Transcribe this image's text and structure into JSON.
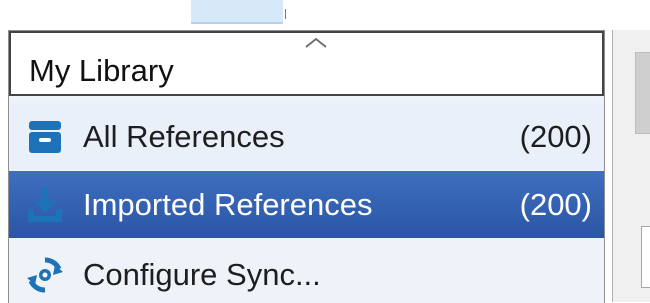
{
  "library": {
    "title": "My Library",
    "items": [
      {
        "label": "All References",
        "count": "(200)",
        "icon": "archive-box-icon"
      },
      {
        "label": "Imported References",
        "count": "(200)",
        "icon": "download-icon",
        "selected": true
      },
      {
        "label": "Configure Sync...",
        "count": "",
        "icon": "sync-icon"
      }
    ]
  },
  "colors": {
    "accent_blue": "#1e73b8",
    "selected_row": "#3a66b4"
  }
}
